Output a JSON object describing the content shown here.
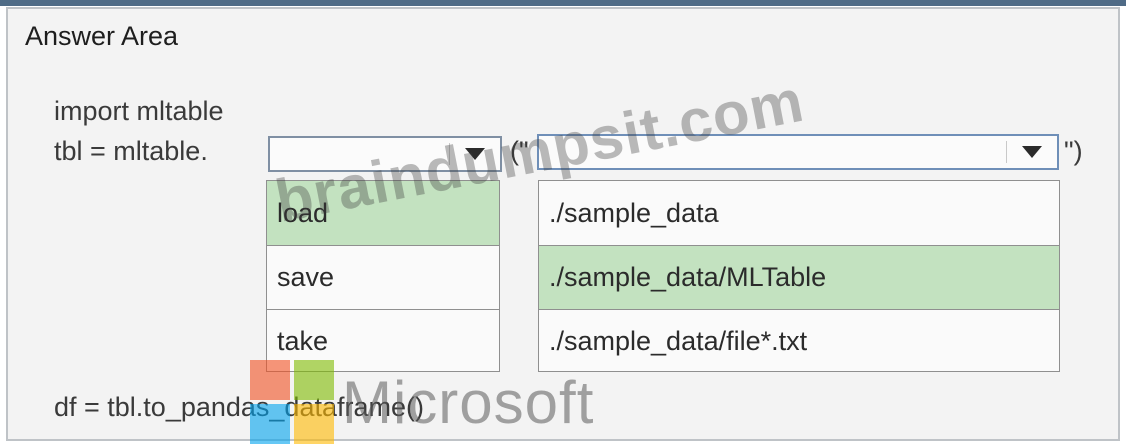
{
  "answer_area": {
    "title": "Answer Area"
  },
  "code": {
    "line1": "import mltable",
    "line2_prefix": "tbl = mltable.",
    "open_quote": "(\"",
    "close_quote": "\")",
    "line_last": "df = tbl.to_pandas_dataframe()"
  },
  "method_dropdown": {
    "selected_value": "",
    "options": [
      {
        "label": "load",
        "highlighted": true
      },
      {
        "label": "save",
        "highlighted": false
      },
      {
        "label": "take",
        "highlighted": false
      }
    ]
  },
  "path_dropdown": {
    "selected_value": "",
    "options": [
      {
        "label": "./sample_data",
        "highlighted": false
      },
      {
        "label": "./sample_data/MLTable",
        "highlighted": true
      },
      {
        "label": "./sample_data/file*.txt",
        "highlighted": false
      }
    ]
  },
  "watermark": {
    "text": "braindumpsit.com"
  },
  "logo": {
    "text": "Microsoft",
    "colors": [
      "#f25022",
      "#7fba00",
      "#00a4ef",
      "#ffb900"
    ]
  },
  "icons": {
    "dropdown_arrow": "chevron-down-icon"
  },
  "colors": {
    "highlight": "#c3e2c0",
    "combo_border": "#7f8fa3",
    "topbar": "#4f6b86"
  }
}
